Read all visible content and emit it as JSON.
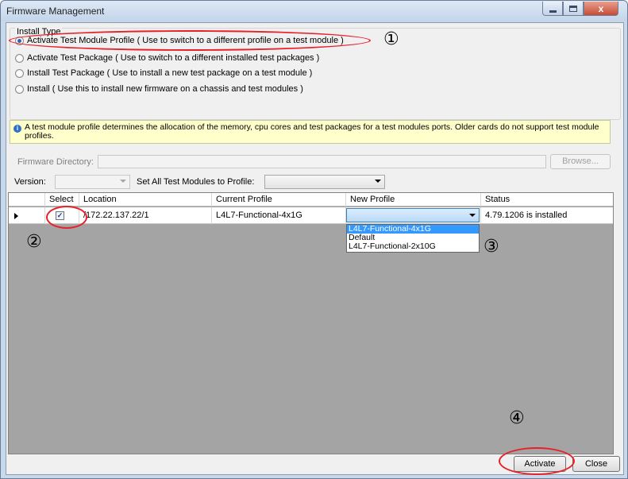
{
  "window": {
    "title": "Firmware Management",
    "controls": {
      "minimize_icon": "minimize-icon",
      "maximize_icon": "maximize-icon",
      "close_icon": "close-icon",
      "close_glyph": "x"
    }
  },
  "install_type": {
    "label": "Install Type",
    "options": [
      {
        "label": "Activate Test Module Profile ( Use to switch to a different profile on a test module )",
        "checked": true
      },
      {
        "label": "Activate Test Package ( Use to switch to a different installed test packages )",
        "checked": false
      },
      {
        "label": "Install Test Package ( Use to install a new test package on a test module )",
        "checked": false
      },
      {
        "label": "Install ( Use this to install new firmware on a chassis and test modules )",
        "checked": false
      }
    ]
  },
  "info": {
    "icon": "info-icon",
    "icon_glyph": "i",
    "text": "A test module profile determines the allocation of the memory, cpu cores and test packages for a test modules ports. Older cards do not support test module profiles."
  },
  "firmware_directory": {
    "label": "Firmware Directory:",
    "value": "",
    "browse_label": "Browse..."
  },
  "version": {
    "label": "Version:",
    "value": ""
  },
  "set_all": {
    "label": "Set All Test Modules to Profile:",
    "value": ""
  },
  "table": {
    "columns": [
      "Select",
      "Location",
      "Current Profile",
      "New Profile",
      "Status"
    ],
    "rows": [
      {
        "selected": true,
        "check_glyph": "✓",
        "location": "/172.22.137.22/1",
        "current_profile": "L4L7-Functional-4x1G",
        "new_profile": "",
        "status": "4.79.1206 is installed"
      }
    ]
  },
  "profile_dropdown": {
    "options": [
      "L4L7-Functional-4x1G",
      "Default",
      "L4L7-Functional-2x10G"
    ],
    "highlighted": "L4L7-Functional-4x1G"
  },
  "annotations": {
    "step1": "①",
    "step2": "②",
    "step3": "③",
    "step4": "④"
  },
  "buttons": {
    "activate_label": "Activate",
    "close_label": "Close"
  },
  "colors": {
    "annotation_red": "#e8202a",
    "selection_blue": "#3399ff",
    "grid_background": "#a4a4a4",
    "info_background": "#ffffcc"
  }
}
